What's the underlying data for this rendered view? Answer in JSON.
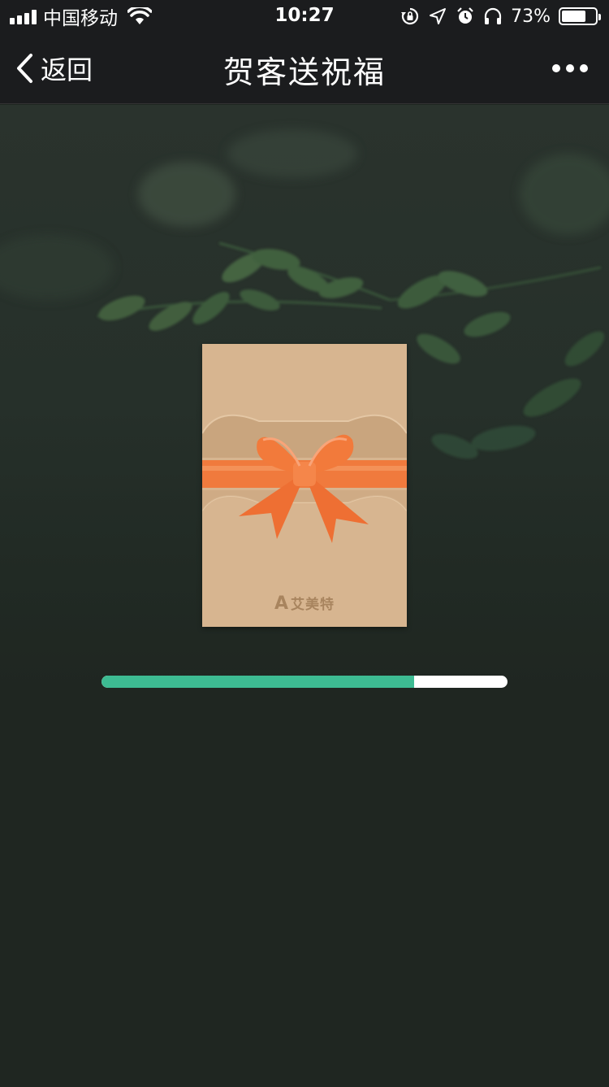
{
  "status_bar": {
    "carrier": "中国移动",
    "time": "10:27",
    "battery_percent": "73%",
    "battery_level": 0.73,
    "icons": [
      "signal-icon",
      "wifi-icon",
      "rotation-lock-icon",
      "location-icon",
      "alarm-icon",
      "headphones-icon",
      "battery-icon"
    ]
  },
  "nav": {
    "back_label": "返回",
    "title": "贺客送祝福",
    "more_icon": "more-dots-icon"
  },
  "card": {
    "brand_mark": "A",
    "brand_name": "艾美特"
  },
  "progress": {
    "value": 0.77
  },
  "colors": {
    "nav_bg": "#1b1c1e",
    "page_bg": "#1f2621",
    "card": "#d6b48f",
    "ribbon": "#f07a3d",
    "progress": "#3dbb92"
  }
}
